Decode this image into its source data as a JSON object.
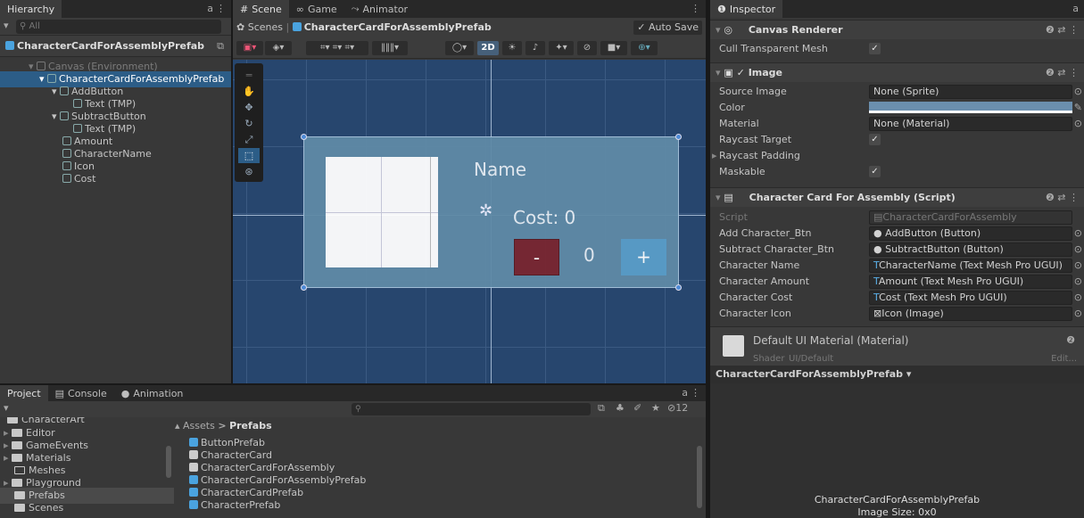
{
  "hierarchy": {
    "tab": "Hierarchy",
    "search_placeholder": "All",
    "title": "CharacterCardForAssemblyPrefab",
    "items": [
      {
        "label": "Canvas (Environment)"
      },
      {
        "label": "CharacterCardForAssemblyPrefab"
      },
      {
        "label": "AddButton"
      },
      {
        "label": "Text (TMP)"
      },
      {
        "label": "SubtractButton"
      },
      {
        "label": "Text (TMP)"
      },
      {
        "label": "Amount"
      },
      {
        "label": "CharacterName"
      },
      {
        "label": "Icon"
      },
      {
        "label": "Cost"
      }
    ]
  },
  "scene": {
    "tabs": [
      "Scene",
      "Game",
      "Animator"
    ],
    "breadcrumb_root": "Scenes",
    "breadcrumb_item": "CharacterCardForAssemblyPrefab",
    "auto_save": "Auto Save",
    "mode_2d": "2D",
    "name_text": "Name",
    "cost_text": "Cost: 0",
    "minus": "-",
    "amount": "0",
    "plus": "+"
  },
  "project": {
    "tabs": [
      "Project",
      "Console",
      "Animation"
    ],
    "filter_count": "12",
    "folders": [
      {
        "label": "CharacterArt"
      },
      {
        "label": "Editor"
      },
      {
        "label": "GameEvents"
      },
      {
        "label": "Materials"
      },
      {
        "label": "Meshes"
      },
      {
        "label": "Playground"
      },
      {
        "label": "Prefabs"
      },
      {
        "label": "Scenes"
      }
    ],
    "path_root": "Assets",
    "path_sep": ">",
    "path_leaf": "Prefabs",
    "assets": [
      {
        "label": "ButtonPrefab",
        "kind": "prefab"
      },
      {
        "label": "CharacterCard",
        "kind": "script"
      },
      {
        "label": "CharacterCardForAssembly",
        "kind": "script"
      },
      {
        "label": "CharacterCardForAssemblyPrefab",
        "kind": "prefab"
      },
      {
        "label": "CharacterCardPrefab",
        "kind": "prefab"
      },
      {
        "label": "CharacterPrefab",
        "kind": "prefab"
      }
    ]
  },
  "inspector": {
    "tab": "Inspector",
    "canvas_renderer": {
      "title": "Canvas Renderer",
      "cull_label": "Cull Transparent Mesh"
    },
    "image": {
      "title": "Image",
      "source_label": "Source Image",
      "source_value": "None (Sprite)",
      "color_label": "Color",
      "material_label": "Material",
      "material_value": "None (Material)",
      "raycast_label": "Raycast Target",
      "padding_label": "Raycast Padding",
      "maskable_label": "Maskable"
    },
    "script": {
      "title": "Character Card For Assembly (Script)",
      "rows": [
        {
          "label": "Script",
          "value": "CharacterCardForAssembly"
        },
        {
          "label": "Add Character_Btn",
          "value": "AddButton (Button)"
        },
        {
          "label": "Subtract Character_Btn",
          "value": "SubtractButton (Button)"
        },
        {
          "label": "Character Name",
          "value": "CharacterName (Text Mesh Pro UGUI)"
        },
        {
          "label": "Character Amount",
          "value": "Amount (Text Mesh Pro UGUI)"
        },
        {
          "label": "Character Cost",
          "value": "Cost (Text Mesh Pro UGUI)"
        },
        {
          "label": "Character Icon",
          "value": "Icon (Image)"
        }
      ]
    },
    "material": {
      "title": "Default UI Material (Material)",
      "shader_label": "Shader",
      "shader_value": "UI/Default",
      "edit": "Edit..."
    },
    "preview": {
      "title": "CharacterCardForAssemblyPrefab",
      "caption": "CharacterCardForAssemblyPrefab",
      "size": "Image Size: 0x0"
    }
  },
  "colors": {
    "accent": "#2c5d87",
    "scene_bg": "#27466e",
    "card": "#5f8aa6",
    "minus": "#7a2630",
    "plus": "#5a9ec9",
    "image_color": "#6b8fae"
  }
}
